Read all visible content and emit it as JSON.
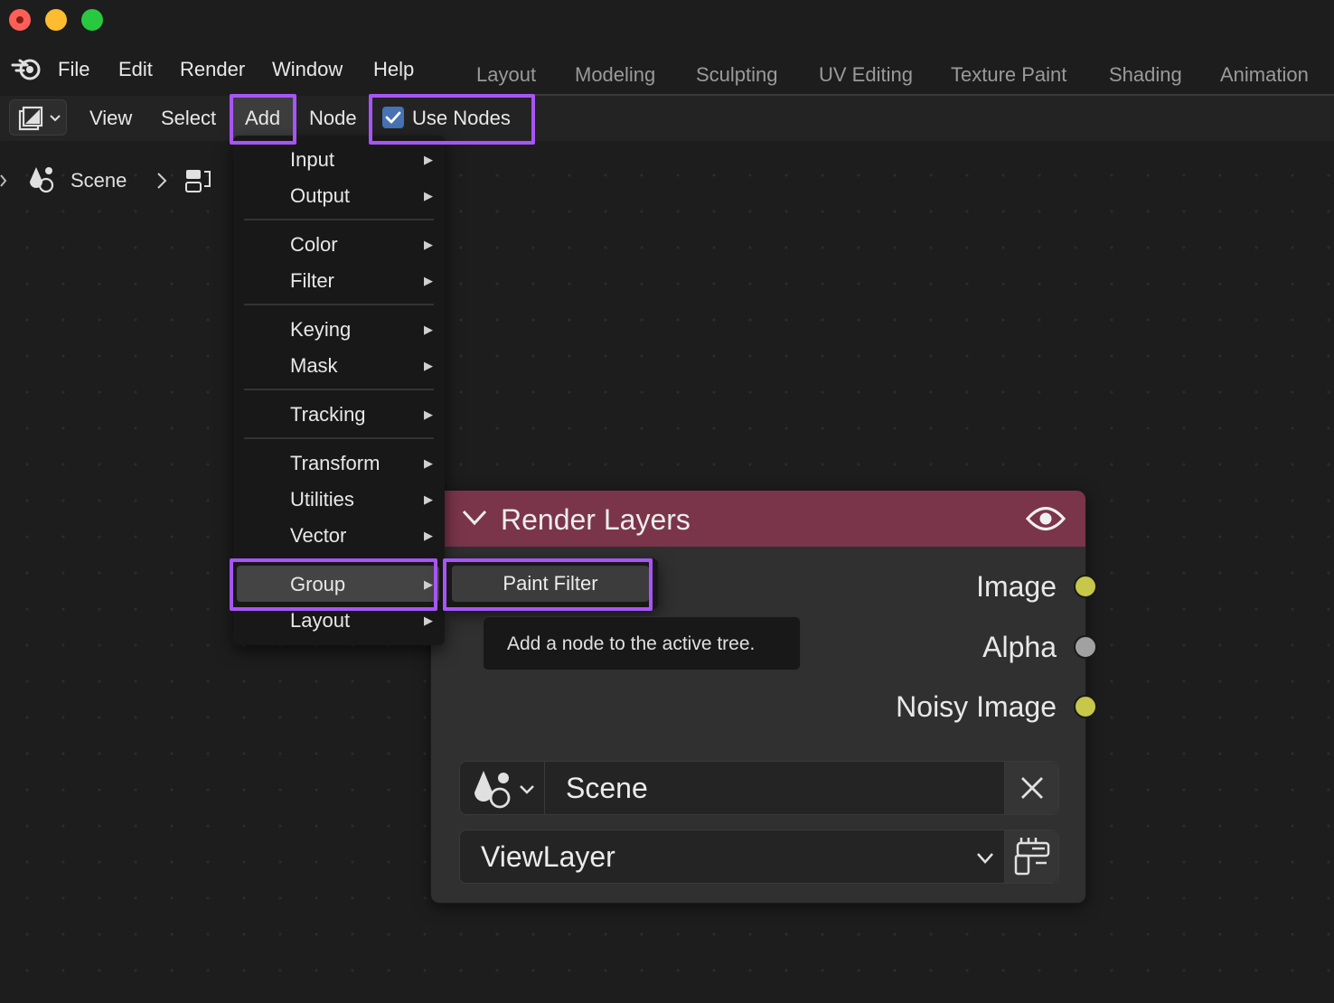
{
  "menubar": {
    "items": [
      "File",
      "Edit",
      "Render",
      "Window",
      "Help"
    ]
  },
  "workspaces": {
    "tabs": [
      "Layout",
      "Modeling",
      "Sculpting",
      "UV Editing",
      "Texture Paint",
      "Shading",
      "Animation"
    ]
  },
  "header": {
    "view_label": "View",
    "select_label": "Select",
    "add_label": "Add",
    "node_label": "Node",
    "use_nodes_label": "Use Nodes",
    "use_nodes_checked": true
  },
  "breadcrumb": {
    "scene_label": "Scene"
  },
  "add_menu": {
    "items": [
      "Input",
      "Output",
      "Color",
      "Filter",
      "Keying",
      "Mask",
      "Tracking",
      "Transform",
      "Utilities",
      "Vector",
      "Group",
      "Layout"
    ],
    "highlighted": "Group"
  },
  "group_submenu": {
    "item": "Paint Filter"
  },
  "tooltip": {
    "text": "Add a node to the active tree."
  },
  "node": {
    "title": "Render Layers",
    "header_color": "#7a354b",
    "outputs": [
      {
        "label": "Image",
        "color": "#c7c74a"
      },
      {
        "label": "Alpha",
        "color": "#a1a1a1"
      },
      {
        "label": "Noisy Image",
        "color": "#c7c74a"
      }
    ],
    "scene_field": "Scene",
    "view_layer_field": "ViewLayer"
  },
  "colors": {
    "highlight": "#a855f7",
    "checkbox": "#4772b3"
  }
}
